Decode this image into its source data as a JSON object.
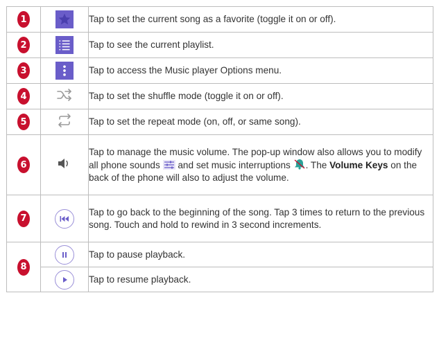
{
  "rows": [
    {
      "num": "1",
      "icon": "star-icon",
      "text": "Tap to set the current song as a favorite (toggle it on or off)."
    },
    {
      "num": "2",
      "icon": "playlist-icon",
      "text": "Tap to see the current playlist."
    },
    {
      "num": "3",
      "icon": "more-options-icon",
      "text": "Tap to access the Music player Options menu."
    },
    {
      "num": "4",
      "icon": "shuffle-icon",
      "text": "Tap to set the shuffle mode (toggle it on or off)."
    },
    {
      "num": "5",
      "icon": "repeat-icon",
      "text": "Tap to set the repeat mode (on, off, or same song)."
    },
    {
      "num": "6",
      "icon": "volume-icon",
      "text_part1": "Tap to manage the music volume. The pop-up window also allows you to modify all phone sounds",
      "text_part2": "and set music interruptions",
      "text_part3": ". The",
      "bold": "Volume Keys",
      "text_part4": "on the back of the phone will also to adjust the volume.",
      "inline_icons": [
        "equalizer-icon",
        "interruptions-bell-icon"
      ]
    },
    {
      "num": "7",
      "icon": "rewind-icon",
      "text": "Tap to go back to the beginning of the song. Tap 3 times to return to the previous song. Touch and hold to rewind in 3 second increments."
    },
    {
      "num": "8",
      "icon": "pause-icon",
      "text": "Tap to pause playback."
    },
    {
      "icon": "play-icon",
      "text": "Tap to resume playback."
    }
  ],
  "colors": {
    "badge": "#c8102e",
    "icon_fill": "#6a5dc9",
    "icon_outline": "#9a8fd8",
    "border": "#bcbcbc"
  }
}
